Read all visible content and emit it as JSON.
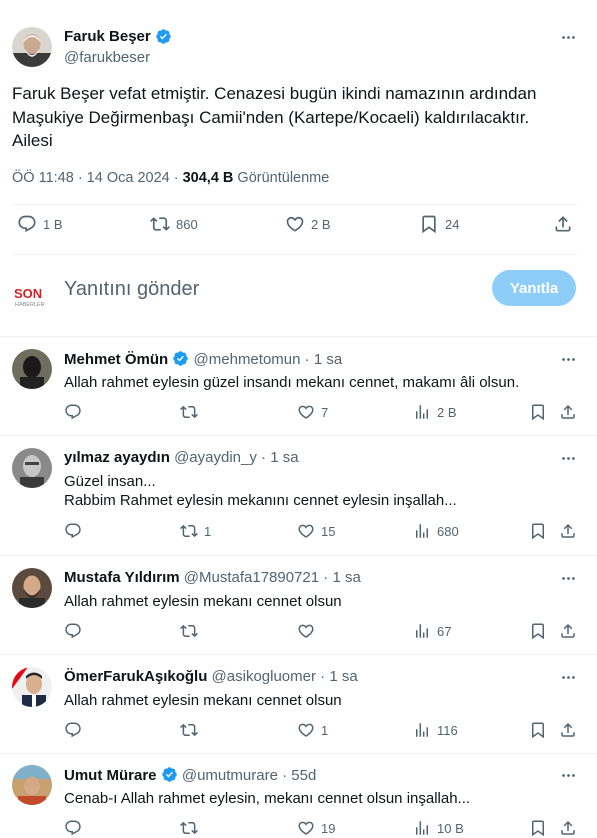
{
  "tweet": {
    "author_name": "Faruk Beşer",
    "author_handle": "@farukbeser",
    "text_lines": [
      "Faruk Beşer vefat etmiştir. Cenazesi bugün ikindi namazının ardından",
      "Maşukiye Değirmenbaşı Camii'nden (Kartepe/Kocaeli) kaldırılacaktır.",
      "Ailesi"
    ],
    "time": "ÖÖ 11:48 · 14 Oca 2024 · ",
    "views_count": "304,4 B",
    "views_label": " Görüntülenme",
    "stats": {
      "replies": "1 B",
      "retweets": "860",
      "likes": "2 B",
      "bookmarks": "24"
    }
  },
  "reply_box": {
    "logo_top": "SON",
    "logo_bottom": "HABERLER",
    "placeholder": "Yanıtını gönder",
    "button_label": "Yanıtla"
  },
  "replies": [
    {
      "name": "Mehmet Ömün",
      "verified": true,
      "handle": "@mehmetomun",
      "time": "1 sa",
      "text_lines": [
        "Allah rahmet eylesin güzel insandı mekanı cennet, makamı âli olsun."
      ],
      "replies_count": "",
      "retweets_count": "",
      "likes_count": "7",
      "views_count": "2 B"
    },
    {
      "name": "yılmaz ayaydın",
      "verified": false,
      "handle": "@ayaydin_y",
      "time": "1 sa",
      "text_lines": [
        "Güzel insan...",
        "Rabbim Rahmet eylesin mekanını cennet eylesin inşallah..."
      ],
      "replies_count": "",
      "retweets_count": "1",
      "likes_count": "15",
      "views_count": "680"
    },
    {
      "name": "Mustafa Yıldırım",
      "verified": false,
      "handle": "@Mustafa17890721",
      "time": "1 sa",
      "text_lines": [
        "Allah rahmet eylesin mekanı cennet olsun"
      ],
      "replies_count": "",
      "retweets_count": "",
      "likes_count": "",
      "views_count": "67"
    },
    {
      "name": "ÖmerFarukAşıkoğlu",
      "verified": false,
      "handle": "@asikogluomer",
      "time": "1 sa",
      "text_lines": [
        "Allah rahmet eylesin mekanı cennet olsun"
      ],
      "replies_count": "",
      "retweets_count": "",
      "likes_count": "1",
      "views_count": "116"
    },
    {
      "name": "Umut Mürare",
      "verified": true,
      "handle": "@umutmurare",
      "time": "55d",
      "text_lines": [
        "Cenab-ı Allah rahmet eylesin, mekanı cennet olsun inşallah..."
      ],
      "replies_count": "",
      "retweets_count": "",
      "likes_count": "19",
      "views_count": "10 B"
    }
  ],
  "icons": {
    "reply": "reply-icon",
    "retweet": "retweet-icon",
    "like": "heart-icon",
    "views": "views-chart-icon",
    "bookmark": "bookmark-icon",
    "share": "share-icon",
    "more": "more-dots-icon",
    "verified": "verified-badge-icon"
  },
  "colors": {
    "accent": "#1d9bf0",
    "button_disabled": "#8ecdf8",
    "text_secondary": "#536471",
    "divider": "#eff3f4"
  }
}
